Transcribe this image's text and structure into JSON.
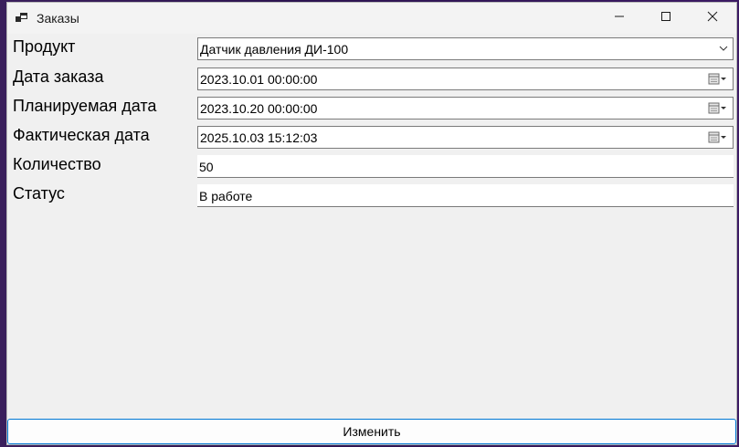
{
  "window": {
    "title": "Заказы",
    "icon": "app-window-icon"
  },
  "form": {
    "product": {
      "label": "Продукт",
      "value": "Датчик давления ДИ-100"
    },
    "order_date": {
      "label": "Дата заказа",
      "value": "2023.10.01 00:00:00"
    },
    "planned_date": {
      "label": "Планируемая дата",
      "value": "2023.10.20 00:00:00"
    },
    "actual_date": {
      "label": "Фактическая дата",
      "value": "2025.10.03 15:12:03"
    },
    "quantity": {
      "label": "Количество",
      "value": "50"
    },
    "status": {
      "label": "Статус",
      "value": "В работе"
    }
  },
  "actions": {
    "edit_label": "Изменить"
  },
  "colors": {
    "window_bg": "#f0f0f0",
    "accent": "#0078d4"
  }
}
